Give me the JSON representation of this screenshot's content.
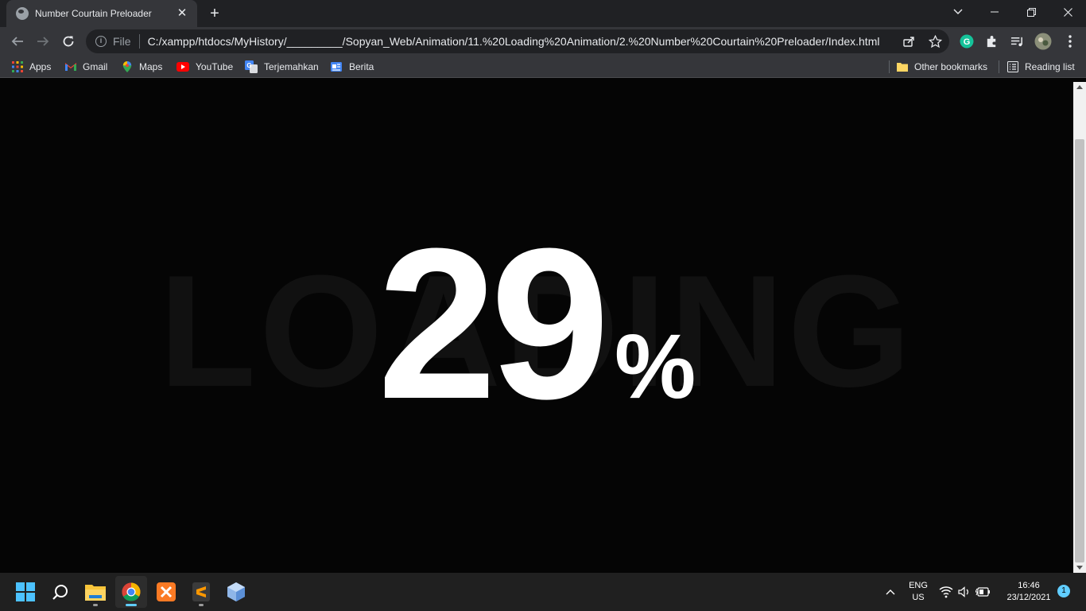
{
  "browser": {
    "tab": {
      "title": "Number Courtain Preloader",
      "close_symbol": "✕"
    },
    "new_tab_symbol": "+",
    "address": {
      "scheme_label": "File",
      "url": "C:/xampp/htdocs/MyHistory/_________/Sopyan_Web/Animation/11.%20Loading%20Animation/2.%20Number%20Courtain%20Preloader/Index.html"
    },
    "bookmarks": [
      {
        "label": "Apps",
        "icon": "apps-grid-icon"
      },
      {
        "label": "Gmail",
        "icon": "gmail-icon"
      },
      {
        "label": "Maps",
        "icon": "maps-icon"
      },
      {
        "label": "YouTube",
        "icon": "youtube-icon"
      },
      {
        "label": "Terjemahkan",
        "icon": "translate-icon"
      },
      {
        "label": "Berita",
        "icon": "news-icon"
      }
    ],
    "other_bookmarks": "Other bookmarks",
    "reading_list": "Reading list"
  },
  "page": {
    "background_word": "LOADING",
    "percent_value": "29",
    "percent_sign": "%"
  },
  "taskbar": {
    "language": {
      "line1": "ENG",
      "line2": "US"
    },
    "time": "16:46",
    "date": "23/12/2021",
    "notification_count": "1"
  },
  "colors": {
    "page_bg": "#050505",
    "percent_text": "#ffffff",
    "background_word": "#111111",
    "chrome_dark": "#202124",
    "chrome_toolbar": "#35363a",
    "accent": "#60cdff"
  }
}
